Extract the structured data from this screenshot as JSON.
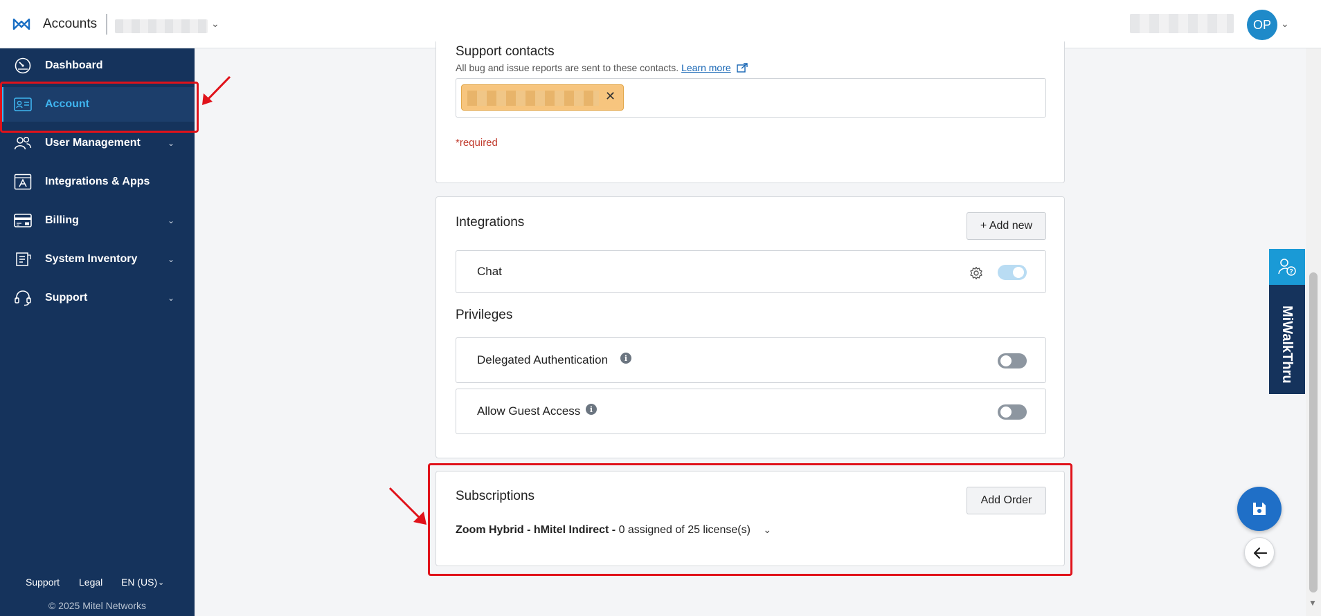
{
  "header": {
    "app_title": "Accounts",
    "avatar_initials": "OP"
  },
  "sidebar": {
    "items": [
      {
        "label": "Dashboard",
        "icon": "dashboard-icon"
      },
      {
        "label": "Account",
        "icon": "account-card-icon",
        "active": true
      },
      {
        "label": "User Management",
        "icon": "users-icon",
        "expandable": true
      },
      {
        "label": "Integrations & Apps",
        "icon": "apps-icon"
      },
      {
        "label": "Billing",
        "icon": "billing-card-icon",
        "expandable": true
      },
      {
        "label": "System Inventory",
        "icon": "inventory-icon",
        "expandable": true
      },
      {
        "label": "Support",
        "icon": "headset-icon",
        "expandable": true
      }
    ],
    "footer": {
      "support": "Support",
      "legal": "Legal",
      "language": "EN (US)",
      "copyright": "© 2025 Mitel Networks"
    }
  },
  "support_contacts": {
    "title": "Support contacts",
    "description": "All bug and issue reports are sent to these contacts.",
    "learn_more": "Learn more",
    "required": "*required"
  },
  "integrations": {
    "title": "Integrations",
    "add_new": "+ Add new",
    "items": [
      {
        "label": "Chat",
        "enabled": true
      }
    ]
  },
  "privileges": {
    "title": "Privileges",
    "items": [
      {
        "label": "Delegated Authentication",
        "enabled": false
      },
      {
        "label": "Allow Guest Access",
        "enabled": false
      }
    ]
  },
  "subscriptions": {
    "title": "Subscriptions",
    "add_order": "Add Order",
    "items": [
      {
        "name": "Zoom Hybrid - hMitel Indirect -",
        "detail": "0 assigned of 25 license(s)"
      }
    ]
  },
  "walkthru": {
    "label": "MiWalkThru"
  },
  "colors": {
    "sidebar_bg": "#15335c",
    "accent": "#3fb5f0",
    "annotation": "#e0121a",
    "chip_bg": "#f7c57e"
  }
}
